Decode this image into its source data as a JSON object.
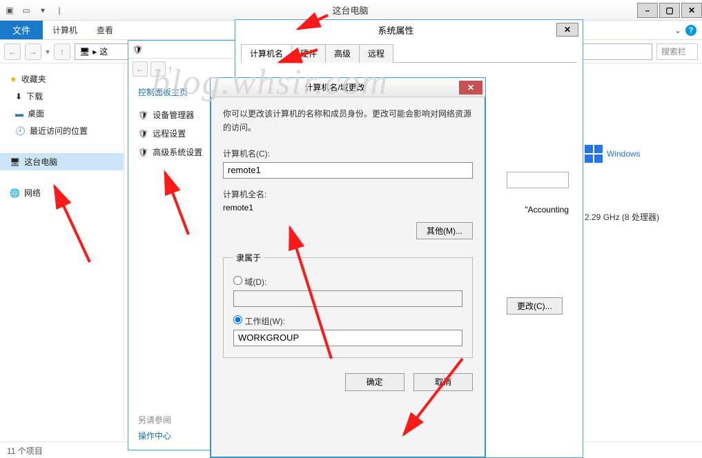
{
  "explorer": {
    "title": "这台电脑",
    "ribbon": {
      "file": "文件",
      "computer": "计算机",
      "view": "查看"
    },
    "nav": {
      "favorites": "收藏夹",
      "downloads": "下载",
      "desktop": "桌面",
      "recent": "最近访问的位置",
      "thispc": "这台电脑",
      "network": "网络"
    },
    "addr": "这",
    "status": "11 个项目",
    "search_placeholder": "搜索栏"
  },
  "controlpanel": {
    "home": "控制面板主页",
    "links": [
      "设备管理器",
      "远程设置",
      "高级系统设置"
    ],
    "seealso": "另请参阅",
    "actioncenter": "操作中心"
  },
  "sysprops": {
    "title": "系统属性",
    "tabs": [
      "计算机名",
      "硬件",
      "高级",
      "远程"
    ],
    "example_suffix": "\"Accounting",
    "change_btn": "更改(C)...",
    "cpu": "2.29 GHz  (8 处理器)"
  },
  "rename": {
    "title": "计算机名/域更改",
    "desc": "你可以更改该计算机的名称和成员身份。更改可能会影响对网络资源的访问。",
    "name_label": "计算机名(C):",
    "name_value": "remote1",
    "fullname_label": "计算机全名:",
    "fullname_value": "remote1",
    "other_btn": "其他(M)...",
    "member_legend": "隶属于",
    "domain_label": "域(D):",
    "domain_value": "",
    "workgroup_label": "工作组(W):",
    "workgroup_value": "WORKGROUP",
    "ok": "确定",
    "cancel": "取消"
  },
  "branding": {
    "windows": "Windows"
  },
  "watermark": "blog.whsir.com"
}
